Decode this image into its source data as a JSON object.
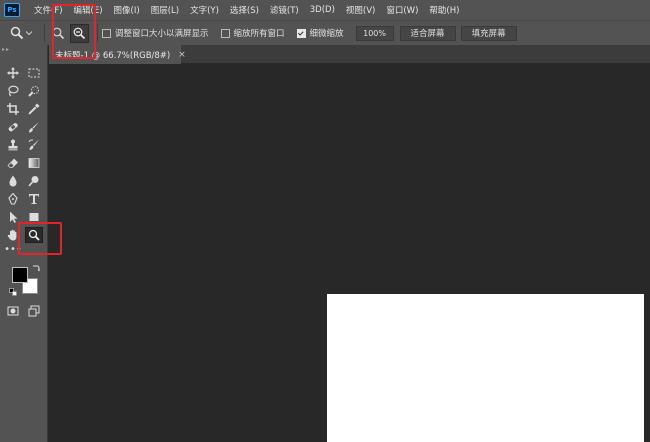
{
  "app": {
    "logo": "Ps"
  },
  "menu": [
    "文件(F)",
    "编辑(E)",
    "图像(I)",
    "图层(L)",
    "文字(Y)",
    "选择(S)",
    "滤镜(T)",
    "3D(D)",
    "视图(V)",
    "窗口(W)",
    "帮助(H)"
  ],
  "options": {
    "resize_windows": "调整窗口大小以满屏显示",
    "zoom_all": "缩放所有窗口",
    "scrubby_zoom": "细微缩放",
    "zoom_value": "100%",
    "fit_screen": "适合屏幕",
    "fill_screen": "填充屏幕",
    "resize_checked": false,
    "zoom_all_checked": false,
    "scrubby_checked": true
  },
  "document": {
    "tab_title": "未标题-1 @ 66.7%(RGB/8#)",
    "close_symbol": "×"
  },
  "colors": {
    "foreground": "#000000",
    "background": "#ffffff",
    "highlight": "#e0252b"
  }
}
